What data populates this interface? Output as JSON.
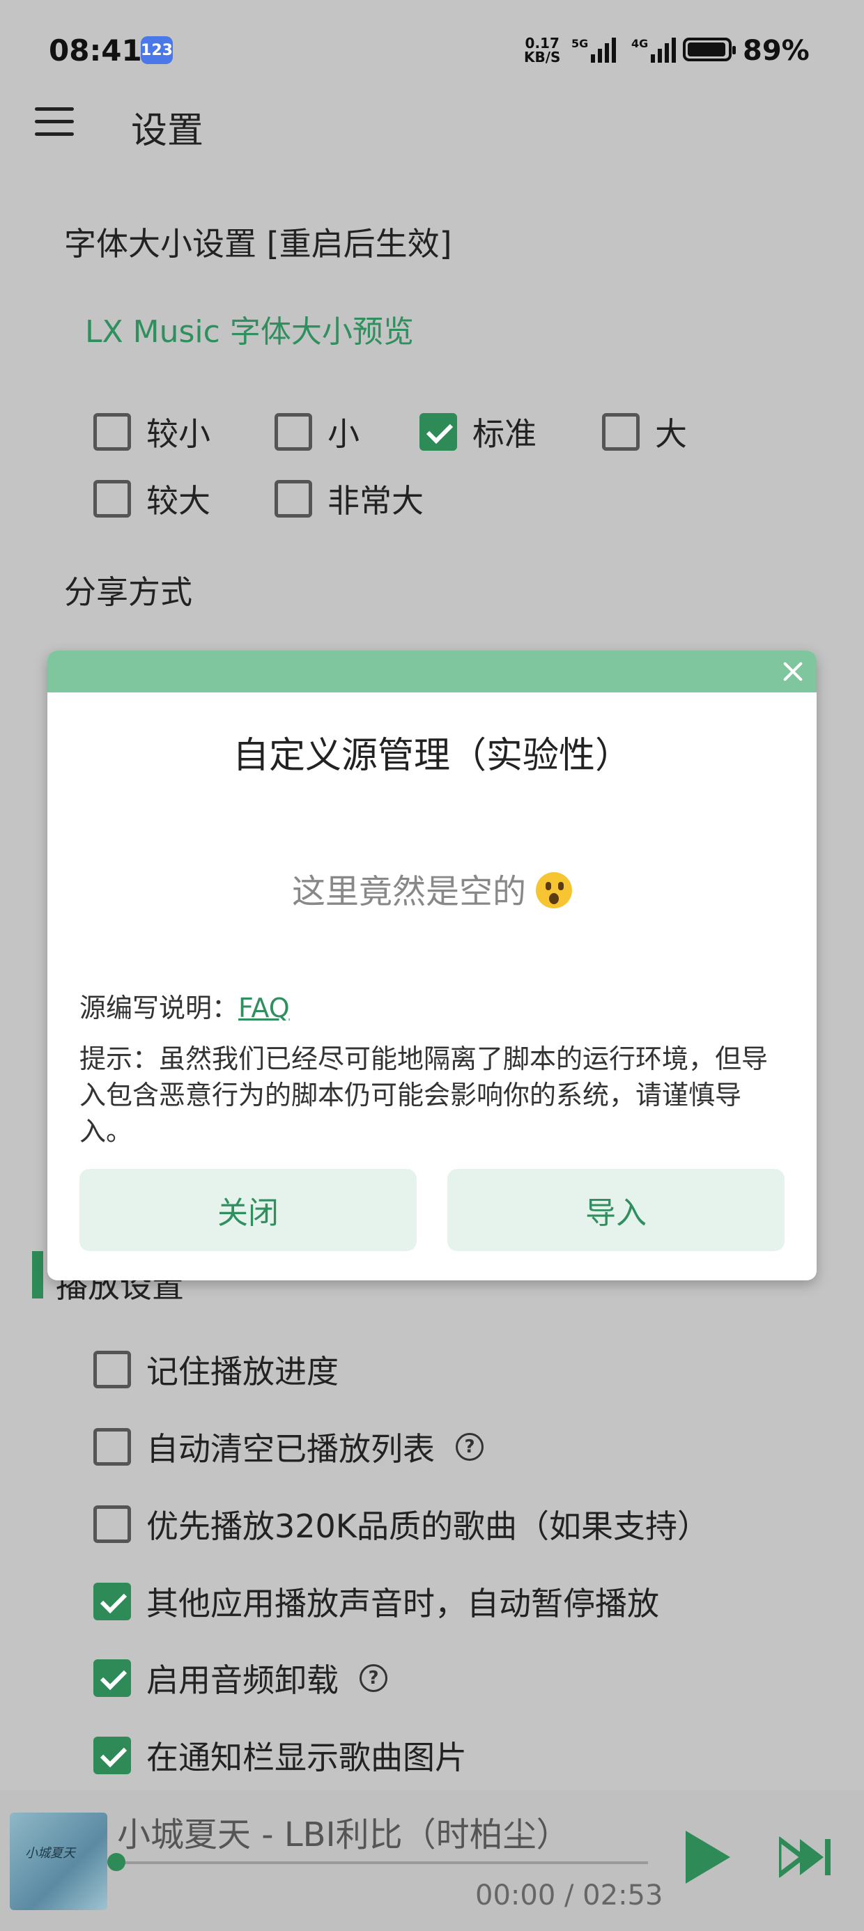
{
  "status_bar": {
    "time": "08:41",
    "badge": "123",
    "net_speed_value": "0.17",
    "net_speed_unit": "KB/S",
    "signal1": "5G",
    "signal2": "4G",
    "battery": "89%"
  },
  "header": {
    "title": "设置"
  },
  "font_size": {
    "heading": "字体大小设置 [重启后生效]",
    "preview": "LX Music 字体大小预览",
    "options": [
      {
        "label": "较小",
        "checked": false
      },
      {
        "label": "小",
        "checked": false
      },
      {
        "label": "标准",
        "checked": true
      },
      {
        "label": "大",
        "checked": false
      },
      {
        "label": "较大",
        "checked": false
      },
      {
        "label": "非常大",
        "checked": false
      }
    ]
  },
  "share": {
    "heading": "分享方式"
  },
  "dialog": {
    "title": "自定义源管理（实验性）",
    "empty_text": "这里竟然是空的",
    "faq_prefix": "源编写说明：",
    "faq_link": "FAQ",
    "tip": "提示：虽然我们已经尽可能地隔离了脚本的运行环境，但导入包含恶意行为的脚本仍可能会影响你的系统，请谨慎导入。",
    "close_label": "关闭",
    "import_label": "导入"
  },
  "playback": {
    "heading": "播放设置",
    "options": [
      {
        "label": "记住播放进度",
        "checked": false,
        "help": false
      },
      {
        "label": "自动清空已播放列表",
        "checked": false,
        "help": true
      },
      {
        "label": "优先播放320K品质的歌曲（如果支持）",
        "checked": false,
        "help": false
      },
      {
        "label": "其他应用播放声音时，自动暂停播放",
        "checked": true,
        "help": false
      },
      {
        "label": "启用音频卸载",
        "checked": true,
        "help": true
      },
      {
        "label": "在通知栏显示歌曲图片",
        "checked": true,
        "help": false
      }
    ]
  },
  "player": {
    "song": "小城夏天 - LBI利比（时柏尘）",
    "time": "00:00 / 02:53",
    "progress": 0,
    "art_text": "小城夏天"
  },
  "colors": {
    "accent": "#2e8b57",
    "dialog_header": "#7fc69f",
    "overlay_bg": "#c4c4c4"
  }
}
